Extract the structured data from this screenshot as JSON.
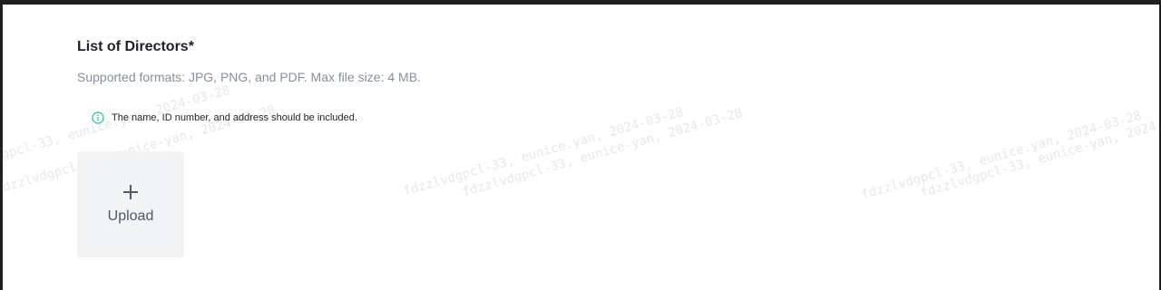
{
  "section": {
    "title": "List of Directors*",
    "formats_hint": "Supported formats: JPG, PNG, and PDF. Max file size: 4 MB.",
    "note": "The name, ID number, and address should be included.",
    "note_icon": "info-icon"
  },
  "upload": {
    "label": "Upload",
    "icon": "plus-icon"
  },
  "watermark": {
    "text_a": "fdzzlvdgpcl-33, eunice.yan, 2024-03-28",
    "text_b": "fdzzlvdgpcl-33, eunice-yan, 2024-03-28"
  },
  "colors": {
    "info_icon": "#14c9a6",
    "title": "#1d2129",
    "hint": "#86909c",
    "upload_bg": "#f2f3f5",
    "upload_text": "#4e5969"
  }
}
